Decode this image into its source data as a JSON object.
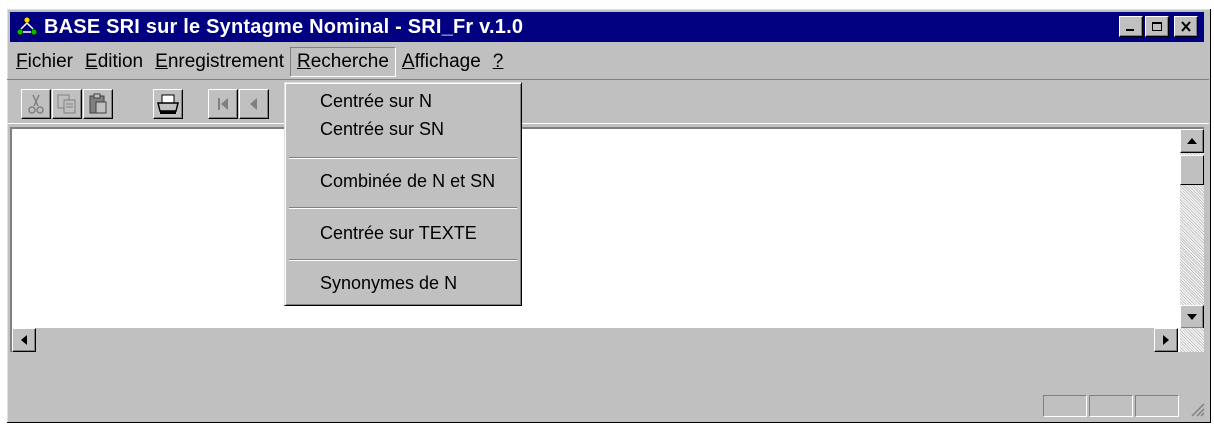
{
  "window": {
    "title": "BASE SRI sur le Syntagme Nominal - SRI_Fr v.1.0",
    "app_icon": "network-icon",
    "controls": [
      "minimize-icon",
      "maximize-icon",
      "close-icon"
    ]
  },
  "menubar": {
    "items": [
      {
        "accel": "F",
        "rest": "ichier"
      },
      {
        "accel": "E",
        "rest": "dition"
      },
      {
        "accel": "E",
        "rest": "nregistrement"
      },
      {
        "accel": "R",
        "rest": "echerche"
      },
      {
        "accel": "A",
        "rest": "ffichage"
      },
      {
        "accel": "?",
        "rest": ""
      }
    ],
    "active_index": 3
  },
  "toolbar": {
    "buttons": [
      "cut-icon",
      "copy-icon",
      "paste-icon",
      "print-icon",
      "first-record-icon",
      "previous-record-icon"
    ]
  },
  "dropdown": {
    "items": [
      "Centrée  sur  N",
      "Centrée  sur  SN",
      "Combinée de N et SN",
      "Centrée  sur  TEXTE",
      "Synonymes de N"
    ]
  },
  "colors": {
    "titlebar": "#000080",
    "face": "#c0c0c0",
    "client": "#ffffff"
  }
}
